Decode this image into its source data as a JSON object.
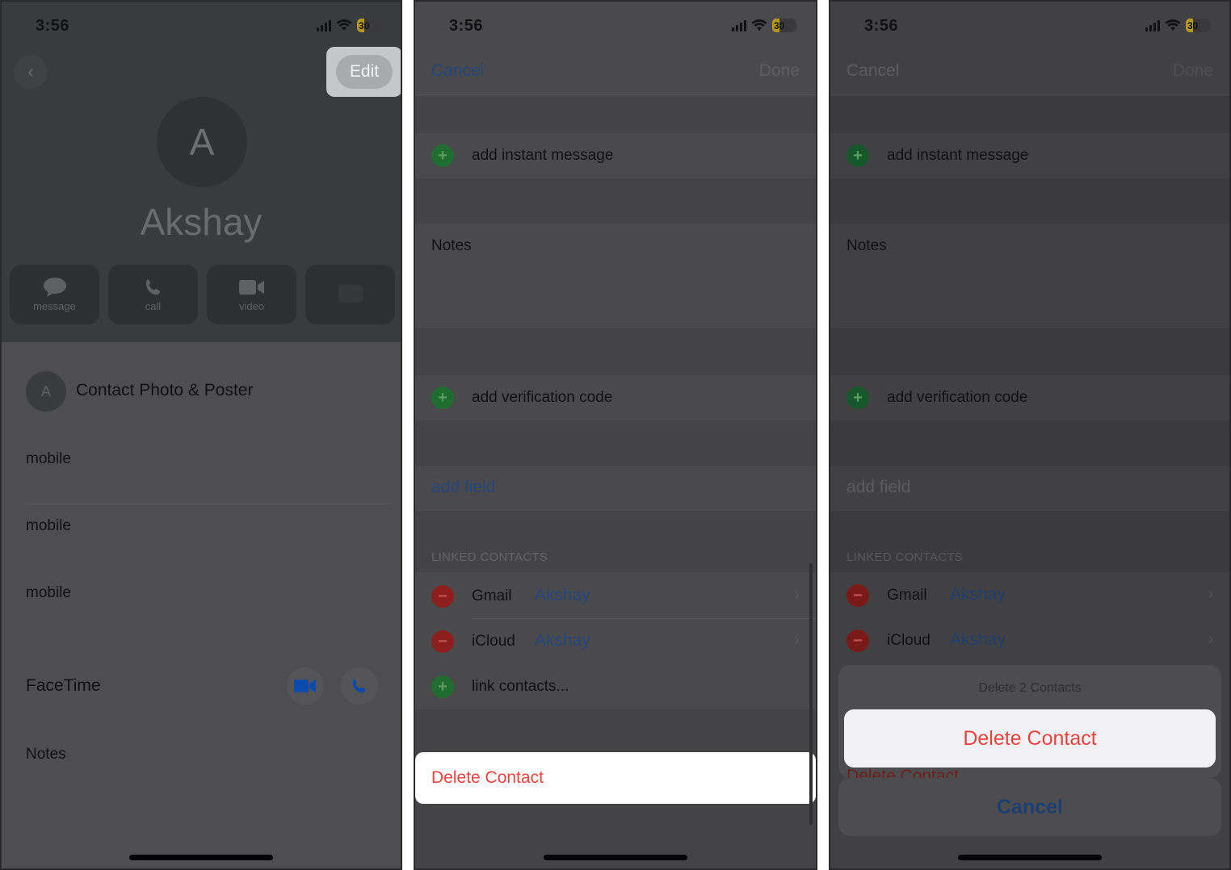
{
  "status_bar": {
    "time": "3:56",
    "battery": "30",
    "battery_level_percent": 30
  },
  "screen1": {
    "edit_label": "Edit",
    "avatar_initial": "A",
    "contact_name": "Akshay",
    "actions": [
      {
        "label": "message",
        "icon": "message-bubble-icon"
      },
      {
        "label": "call",
        "icon": "phone-icon"
      },
      {
        "label": "video",
        "icon": "video-camera-icon"
      },
      {
        "label": "",
        "icon": "mail-icon"
      }
    ],
    "photo_poster_label": "Contact Photo & Poster",
    "phone_labels": [
      "mobile",
      "mobile",
      "mobile"
    ],
    "facetime_label": "FaceTime",
    "notes_label": "Notes"
  },
  "screen2": {
    "cancel_label": "Cancel",
    "done_label": "Done",
    "add_instant_message": "add instant message",
    "notes_label": "Notes",
    "add_verification_code": "add verification code",
    "add_field": "add field",
    "linked_contacts_header": "LINKED CONTACTS",
    "linked_contacts": [
      {
        "source": "Gmail",
        "name": "Akshay"
      },
      {
        "source": "iCloud",
        "name": "Akshay"
      }
    ],
    "link_contacts": "link contacts...",
    "delete_contact": "Delete Contact"
  },
  "screen3": {
    "cancel_label": "Cancel",
    "done_label": "Done",
    "add_instant_message": "add instant message",
    "notes_label": "Notes",
    "add_verification_code": "add verification code",
    "add_field": "add field",
    "linked_contacts_header": "LINKED CONTACTS",
    "linked_contacts": [
      {
        "source": "Gmail",
        "name": "Akshay"
      },
      {
        "source": "iCloud",
        "name": "Akshay"
      }
    ],
    "background_delete_contact": "Delete Contact",
    "action_sheet": {
      "title": "Delete 2 Contacts",
      "delete_label": "Delete Contact",
      "cancel_label": "Cancel"
    }
  },
  "colors": {
    "destructive": "#e8433f",
    "link_blue": "#24467a",
    "add_green": "#1f6e30",
    "remove_red": "#8c1f1d",
    "facetime_blue": "#0a4aa8"
  }
}
